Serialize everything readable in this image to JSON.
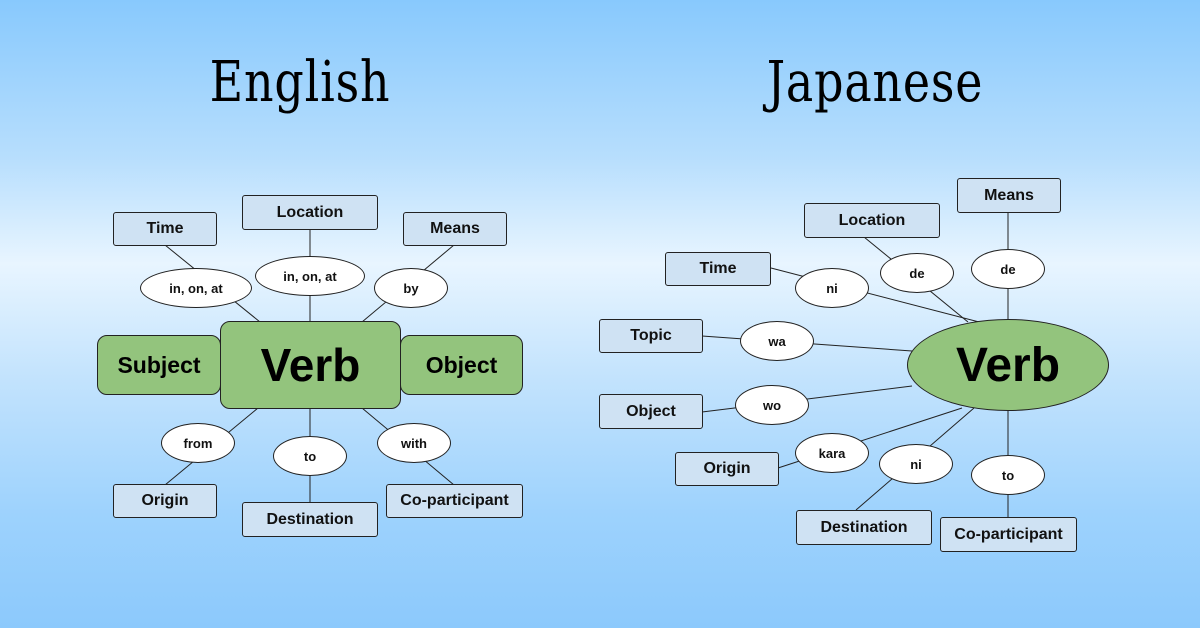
{
  "titles": {
    "english": "English",
    "japanese": "Japanese"
  },
  "english": {
    "center": "Verb",
    "subject": "Subject",
    "object": "Object",
    "roles": [
      {
        "role": "Time",
        "marker": "in, on, at"
      },
      {
        "role": "Location",
        "marker": "in, on, at"
      },
      {
        "role": "Means",
        "marker": "by"
      },
      {
        "role": "Origin",
        "marker": "from"
      },
      {
        "role": "Destination",
        "marker": "to"
      },
      {
        "role": "Co-participant",
        "marker": "with"
      }
    ]
  },
  "japanese": {
    "center": "Verb",
    "roles": [
      {
        "role": "Time",
        "marker": "ni"
      },
      {
        "role": "Location",
        "marker": "de"
      },
      {
        "role": "Means",
        "marker": "de"
      },
      {
        "role": "Topic",
        "marker": "wa"
      },
      {
        "role": "Object",
        "marker": "wo"
      },
      {
        "role": "Origin",
        "marker": "kara"
      },
      {
        "role": "Destination",
        "marker": "ni"
      },
      {
        "role": "Co-participant",
        "marker": "to"
      }
    ]
  }
}
